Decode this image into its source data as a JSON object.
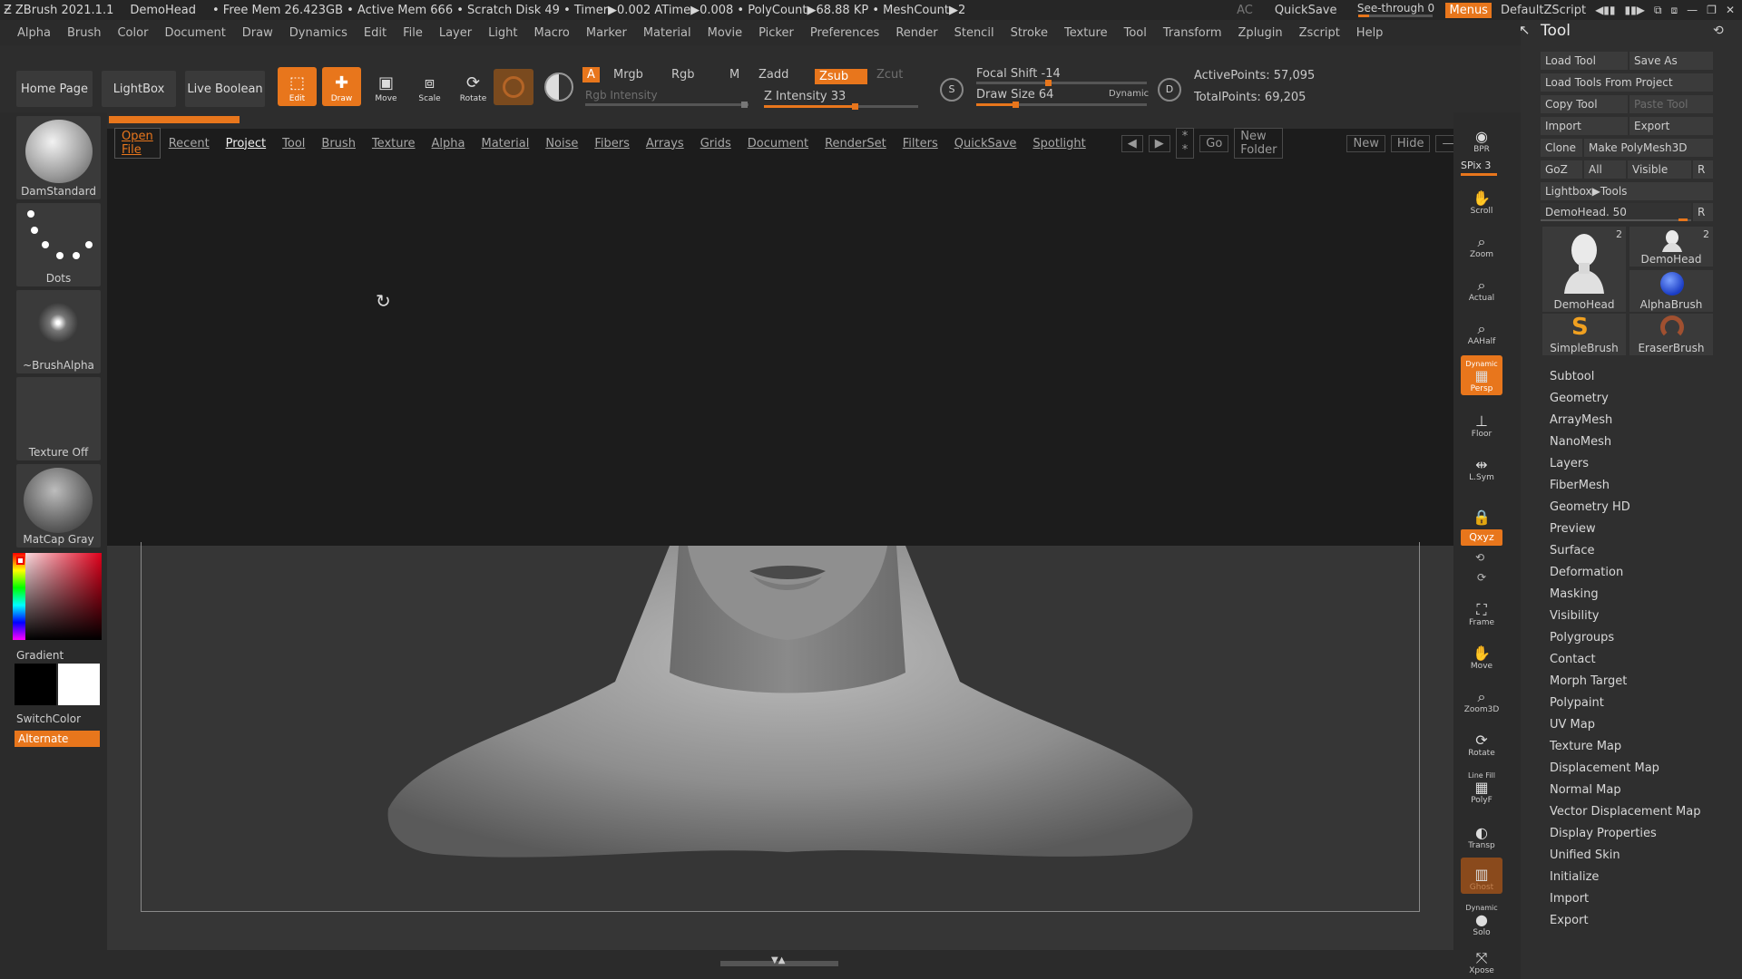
{
  "titlebar": {
    "app": "ZBrush 2021.1.1",
    "doc": "DemoHead",
    "stats": "• Free Mem 26.423GB • Active Mem 666 • Scratch Disk 49 • Timer▶0.002 ATime▶0.008 • PolyCount▶68.88 KP • MeshCount▶2",
    "ac": "AC",
    "quicksave": "QuickSave",
    "seethrough": "See-through  0",
    "menus": "Menus",
    "script": "DefaultZScript"
  },
  "menubar": [
    "Alpha",
    "Brush",
    "Color",
    "Document",
    "Draw",
    "Dynamics",
    "Edit",
    "File",
    "Layer",
    "Light",
    "Macro",
    "Marker",
    "Material",
    "Movie",
    "Picker",
    "Preferences",
    "Render",
    "Stencil",
    "Stroke",
    "Texture",
    "Tool",
    "Transform",
    "Zplugin",
    "Zscript",
    "Help"
  ],
  "shelf": {
    "home": "Home Page",
    "lightbox": "LightBox",
    "liveboolean": "Live Boolean",
    "edit": "Edit",
    "draw": "Draw",
    "move": "Move",
    "scale": "Scale",
    "rotate": "Rotate",
    "a": "A",
    "mrgb": "Mrgb",
    "rgb": "Rgb",
    "m": "M",
    "rgb_intensity": "Rgb Intensity",
    "zadd": "Zadd",
    "zsub": "Zsub",
    "zcut": "Zcut",
    "z_intensity": "Z Intensity 33",
    "focal_shift": "Focal Shift -14",
    "draw_size": "Draw Size 64",
    "dynamic": "Dynamic",
    "active_points": "ActivePoints: 57,095",
    "total_points": "TotalPoints: 69,205",
    "s": "S",
    "d": "D"
  },
  "leftbar": {
    "brush": "DamStandard",
    "stroke": "Dots",
    "alpha": "~BrushAlpha",
    "texture": "Texture Off",
    "material": "MatCap Gray",
    "gradient": "Gradient",
    "switchcolor": "SwitchColor",
    "alternate": "Alternate"
  },
  "lightbox": {
    "tabs": [
      "Open File",
      "Recent",
      "Project",
      "Tool",
      "Brush",
      "Texture",
      "Alpha",
      "Material",
      "Noise",
      "Fibers",
      "Arrays",
      "Grids",
      "Document",
      "RenderSet",
      "Filters",
      "QuickSave",
      "Spotlight"
    ],
    "search": "* *",
    "go": "Go",
    "new_folder": "New Folder",
    "new": "New",
    "hide": "Hide"
  },
  "rstrip": {
    "bpr": "BPR",
    "spix": "SPix 3",
    "scroll": "Scroll",
    "zoom": "Zoom",
    "actual": "Actual",
    "aahalf": "AAHalf",
    "dynamic": "Dynamic",
    "persp": "Persp",
    "floor": "Floor",
    "lsym": "L.Sym",
    "xyz": "Qxyz",
    "frame": "Frame",
    "move": "Move",
    "zoom3d": "Zoom3D",
    "rotate": "Rotate",
    "linefill": "Line Fill",
    "polyf": "PolyF",
    "transp": "Transp",
    "ghost": "Ghost",
    "dynamic2": "Dynamic",
    "solo": "Solo",
    "xpose": "Xpose"
  },
  "palette": {
    "title": "Tool",
    "load_tool": "Load Tool",
    "save_as": "Save As",
    "load_from_project": "Load Tools From Project",
    "copy_tool": "Copy Tool",
    "paste_tool": "Paste Tool",
    "import": "Import",
    "export": "Export",
    "clone": "Clone",
    "make_polymesh": "Make PolyMesh3D",
    "goz": "GoZ",
    "all": "All",
    "visible": "Visible",
    "r": "R",
    "lightbox_tools": "Lightbox▶Tools",
    "demohead_slider": "DemoHead. 50",
    "thumbs": [
      {
        "name": "DemoHead",
        "count": "2"
      },
      {
        "name": "DemoHead",
        "count": "2"
      },
      {
        "name": "AlphaBrush",
        "count": ""
      },
      {
        "name": "SimpleBrush",
        "count": ""
      },
      {
        "name": "EraserBrush",
        "count": ""
      }
    ],
    "subpalettes": [
      "Subtool",
      "Geometry",
      "ArrayMesh",
      "NanoMesh",
      "Layers",
      "FiberMesh",
      "Geometry HD",
      "Preview",
      "Surface",
      "Deformation",
      "Masking",
      "Visibility",
      "Polygroups",
      "Contact",
      "Morph Target",
      "Polypaint",
      "UV Map",
      "Texture Map",
      "Displacement Map",
      "Normal Map",
      "Vector Displacement Map",
      "Display Properties",
      "Unified Skin",
      "Initialize",
      "Import",
      "Export"
    ]
  },
  "colors": {
    "accent": "#e8761c",
    "bg": "#303030",
    "panel": "#2b2b2b",
    "lightbox": "#1c1c1c"
  }
}
